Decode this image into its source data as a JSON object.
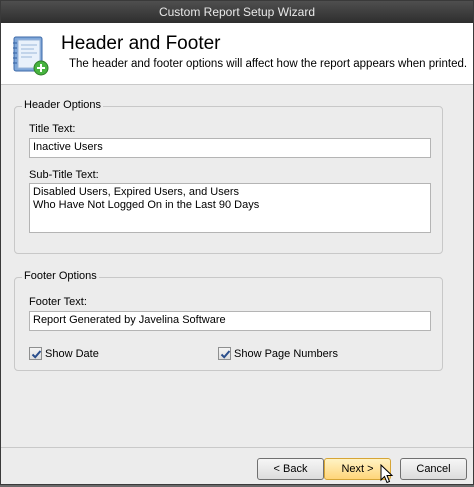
{
  "window": {
    "title": "Custom Report Setup Wizard"
  },
  "banner": {
    "title": "Header and Footer",
    "description": "The header and footer options will affect how the report appears when printed.",
    "icon": "report-add-icon"
  },
  "header_options": {
    "legend": "Header Options",
    "title_label": "Title Text:",
    "title_value": "Inactive Users",
    "subtitle_label": "Sub-Title Text:",
    "subtitle_value": "Disabled Users, Expired Users, and Users\nWho Have Not Logged On in the Last 90 Days"
  },
  "footer_options": {
    "legend": "Footer Options",
    "footer_label": "Footer Text:",
    "footer_value": "Report Generated by Javelina Software",
    "show_date_label": "Show Date",
    "show_date_checked": true,
    "show_page_numbers_label": "Show Page Numbers",
    "show_page_numbers_checked": true
  },
  "buttons": {
    "back": "< Back",
    "next": "Next >",
    "cancel": "Cancel"
  },
  "colors": {
    "titlebar": "#3b3b3b",
    "default_button": "#ffd57a",
    "window_bg": "#ececec"
  }
}
